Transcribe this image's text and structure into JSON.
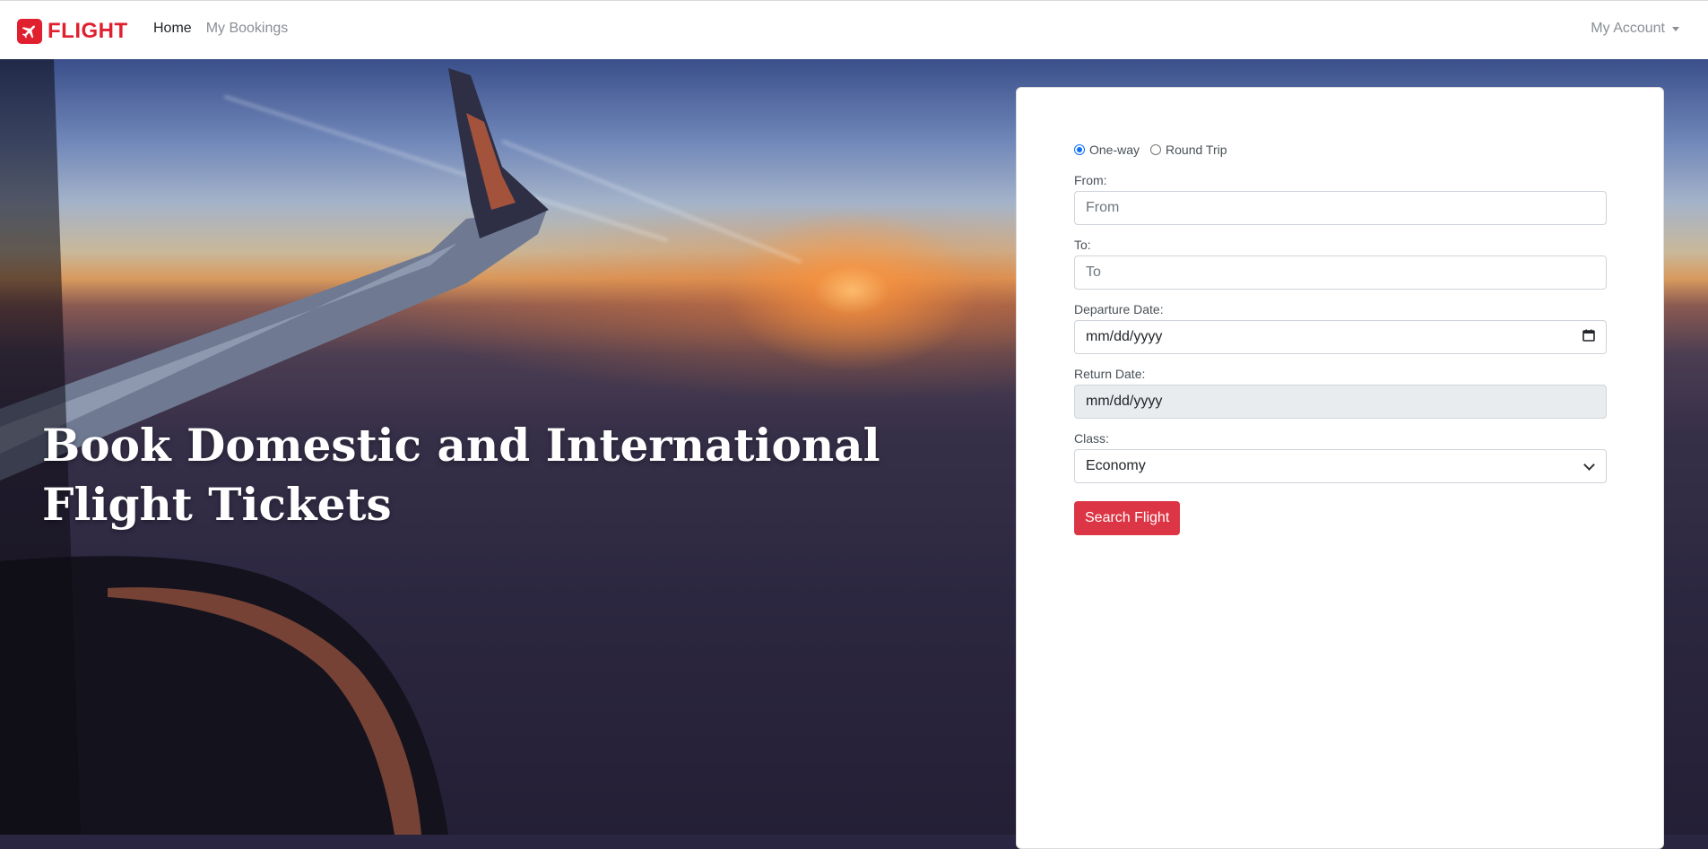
{
  "nav": {
    "brand": "FLIGHT",
    "links": [
      {
        "label": "Home",
        "active": true
      },
      {
        "label": "My Bookings",
        "active": false
      }
    ],
    "account": "My Account"
  },
  "hero": {
    "title_line1": "Book Domestic and International",
    "title_line2": "Flight Tickets"
  },
  "form": {
    "trip_types": [
      {
        "label": "One-way",
        "checked": true
      },
      {
        "label": "Round Trip",
        "checked": false
      }
    ],
    "from_label": "From:",
    "from_placeholder": "From",
    "to_label": "To:",
    "to_placeholder": "To",
    "departure_label": "Departure Date:",
    "departure_value": "mm/dd/yyyy",
    "return_label": "Return Date:",
    "return_value": "mm/dd/yyyy",
    "class_label": "Class:",
    "class_value": "Economy",
    "submit_label": "Search Flight"
  },
  "colors": {
    "brand": "#e0202f",
    "button": "#dc3545",
    "radio_checked": "#0d6efd"
  },
  "icons": [
    "airplane-icon",
    "calendar-icon",
    "chevron-down-icon",
    "caret-down-icon"
  ]
}
